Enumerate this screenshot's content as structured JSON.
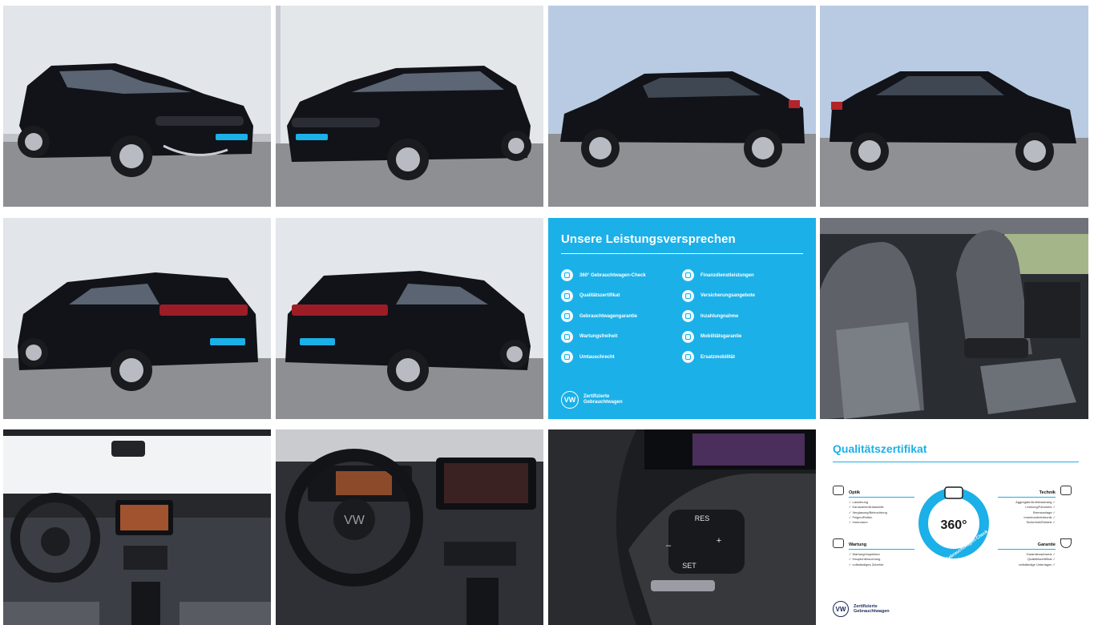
{
  "gallery": {
    "photos": [
      {
        "alt": "front-left-exterior"
      },
      {
        "alt": "front-right-exterior"
      },
      {
        "alt": "left-side-exterior"
      },
      {
        "alt": "right-side-exterior"
      },
      {
        "alt": "rear-left-exterior"
      },
      {
        "alt": "rear-right-exterior"
      },
      {
        "alt": "front-seats-interior"
      },
      {
        "alt": "dashboard-overview"
      },
      {
        "alt": "steering-wheel-cockpit"
      },
      {
        "alt": "steering-wheel-controls"
      }
    ],
    "colors": {
      "brand_blue": "#1bb0e8",
      "car_black": "#111318",
      "wall": "#e3e6ea",
      "pavement": "#8c8d90"
    }
  },
  "promise_panel": {
    "title": "Unsere Leistungsversprechen",
    "left_items": [
      "360° Gebrauchtwagen-Check",
      "Qualitätszertifikat",
      "Gebrauchtwagengarantie",
      "Wartungsfreiheit",
      "Umtauschrecht"
    ],
    "right_items": [
      "Finanzdienstleistungen",
      "Versicherungsangebote",
      "Inzahlungnahme",
      "Mobilitätsgarantie",
      "Ersatzmobilität"
    ],
    "brand_line1": "Zertifizierte",
    "brand_line2": "Gebrauchtwagen",
    "logo_text": "VW"
  },
  "cert_panel": {
    "title": "Qualitätszertifikat",
    "center_value": "360°",
    "ring_text": "Gebrauchtwagen-Check",
    "optik": {
      "heading": "Optik",
      "items": [
        "✓ Lackierung",
        "✓ Karosserie/Anbauteile",
        "✓ Verglasung/Beleuchtung",
        "✓ Felgen/Reifen",
        "✓ Innenraum"
      ]
    },
    "technik": {
      "heading": "Technik",
      "items": [
        "Aggregate/Antriebsstrang ✓",
        "Lenkung/Fahrwerk ✓",
        "Bremsanlage ✓",
        "Innenbordelektronik ✓",
        "Sicherheit/Elektrik ✓"
      ]
    },
    "wartung": {
      "heading": "Wartung",
      "items": [
        "✓ Wartung/Inspektion",
        "✓ Hauptuntersuchung",
        "✓ vollständiges Zubehör"
      ]
    },
    "garantie": {
      "heading": "Garantie",
      "items": [
        "Garantienachweis ✓",
        "Qualitätszertifikat ✓",
        "vollständige Unterlagen ✓"
      ]
    },
    "brand_line1": "Zertifizierte",
    "brand_line2": "Gebrauchtwagen",
    "logo_text": "VW"
  },
  "wheel_controls": {
    "res_label": "RES",
    "set_label": "SET",
    "plus_label": "+",
    "minus_label": "–"
  }
}
